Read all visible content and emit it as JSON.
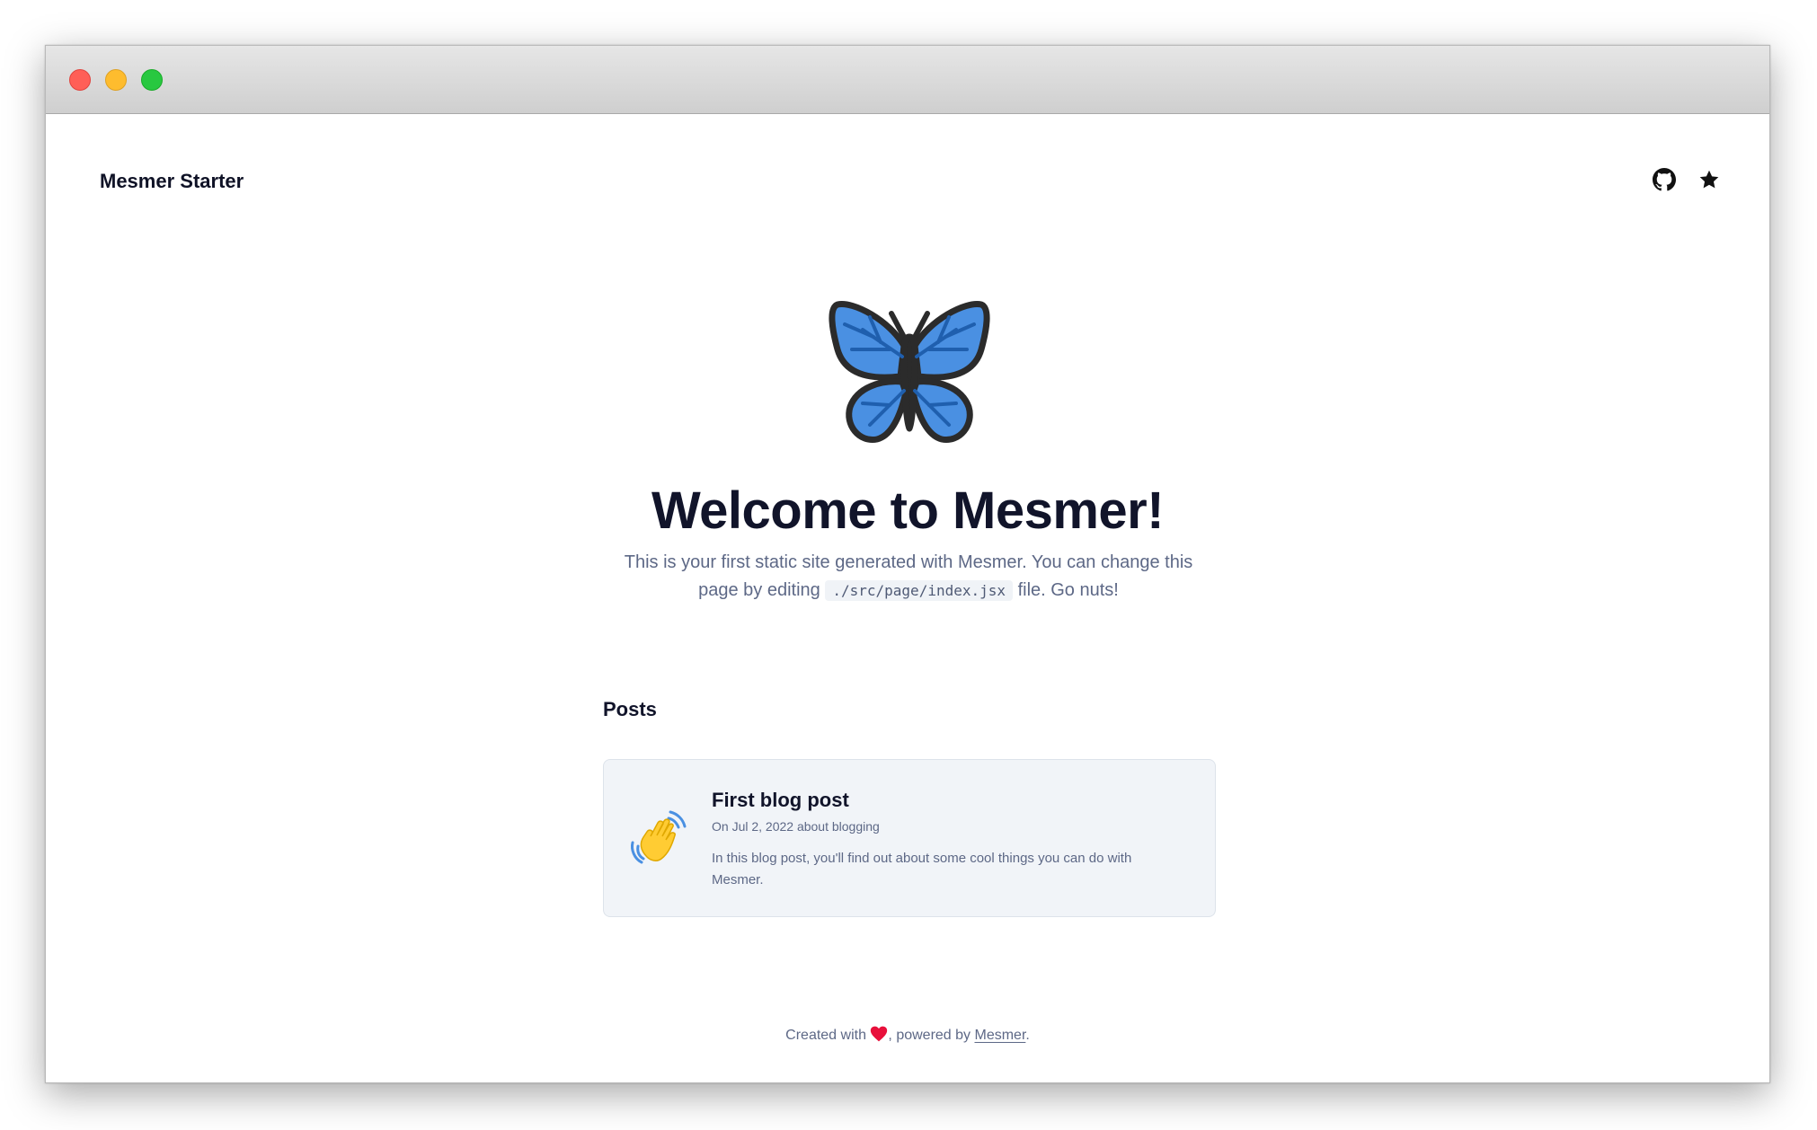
{
  "site": {
    "title": "Mesmer Starter"
  },
  "nav": {
    "icons": [
      "github-icon",
      "star-icon"
    ]
  },
  "hero": {
    "title": "Welcome to Mesmer!",
    "text_before": "This is your first static site generated with Mesmer. You can change this page by editing ",
    "code": "./src/page/index.jsx",
    "text_after": " file. Go nuts!"
  },
  "posts": {
    "heading": "Posts",
    "items": [
      {
        "title": "First blog post",
        "meta": "On Jul 2, 2022 about blogging",
        "excerpt": "In this blog post, you'll find out about some cool things you can do with Mesmer.",
        "icon": "waving-hand-icon"
      }
    ]
  },
  "footer": {
    "prefix": "Created with ",
    "middle": ", powered by ",
    "link": "Mesmer",
    "suffix": "."
  },
  "colors": {
    "accent_blue": "#4a90e2",
    "heart_red": "#e8103b",
    "text_dark": "#11142a",
    "text_muted": "#5d6886",
    "card_bg": "#f1f4f8"
  }
}
